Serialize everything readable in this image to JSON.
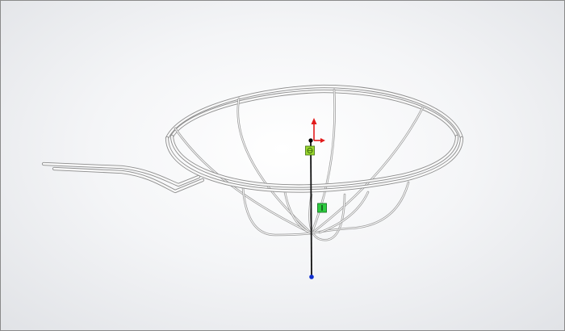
{
  "viewport": {
    "background_colors": [
      "#ffffff",
      "#dfe1e5"
    ],
    "model_color": "#f8f8f8"
  },
  "triad": {
    "x_axis_color": "#e21b1b",
    "y_axis_color": "#e21b1b",
    "origin_color": "#000000",
    "end_point_color": "#1030d0"
  },
  "handles": {
    "start_icon": "sketch-point-handle-icon",
    "start_color": "#9bd62e",
    "mid_icon": "dimension-handle-icon",
    "mid_color": "#2ecc40"
  }
}
